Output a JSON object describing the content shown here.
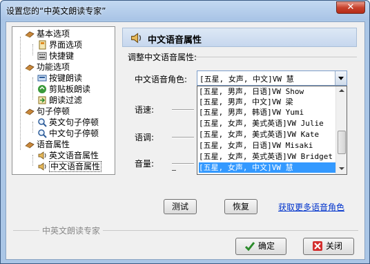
{
  "window": {
    "title": "设置您的“中英文朗读专家”",
    "close_label": "✕"
  },
  "tree": {
    "nodes": [
      {
        "label": "基本选项"
      },
      {
        "label": "界面选项"
      },
      {
        "label": "快捷键"
      },
      {
        "label": "功能选项"
      },
      {
        "label": "按键朗读"
      },
      {
        "label": "剪贴板朗读"
      },
      {
        "label": "朗读过滤"
      },
      {
        "label": "句子停顿"
      },
      {
        "label": "英文句子停顿"
      },
      {
        "label": "中文句子停顿"
      },
      {
        "label": "语音属性"
      },
      {
        "label": "英文语音属性"
      },
      {
        "label": "中文语音属性"
      }
    ]
  },
  "panel": {
    "title": "中文语音属性",
    "group_label": "调整中文语音属性:",
    "voice_label": "中文语音角色:",
    "selected_voice": "[五星, 女声, 中文]VW 慧",
    "speed_label": "语速:",
    "pitch_label": "语调:",
    "volume_label": "音量:",
    "voices": [
      "[五星, 男声, 日语]VW Show",
      "[五星, 男声, 中文]VW 梁",
      "[五星, 男声, 韩语]VW Yumi",
      "[五星, 女声, 美式英语]VW Julie",
      "[五星, 女声, 美式英语]VW Kate",
      "[五星, 女声, 日语]VW Misaki",
      "[五星, 女声, 英式英语]VW Bridget",
      "[五星, 女声, 中文]VW 慧"
    ],
    "test_button": "测试",
    "restore_button": "恢复",
    "more_voices_link": "获取更多语音角色"
  },
  "footer": {
    "brand": "中英文朗读专家",
    "ok_button": "确定",
    "close_button": "关闭"
  },
  "colors": {
    "accent": "#3399ff",
    "link": "#0033cc",
    "titlebar": "#aac6e6"
  },
  "icons": {
    "category": "book-icon",
    "speaker": "speaker-icon",
    "ok": "checkmark-icon",
    "close": "x-icon"
  }
}
